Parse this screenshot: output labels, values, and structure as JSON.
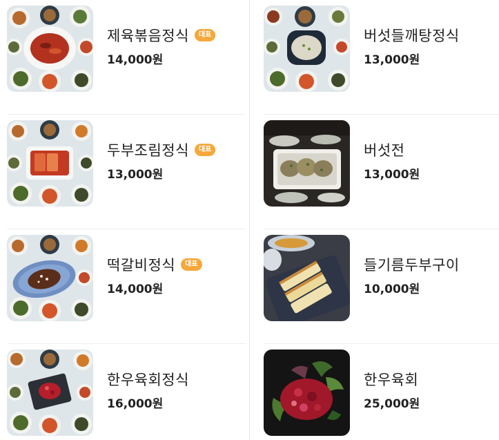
{
  "menu": {
    "items": [
      {
        "name": "제육볶음정식",
        "badge": "대표",
        "price": "14,000원",
        "image": "jeyuk-set"
      },
      {
        "name": "버섯들깨탕정식",
        "badge": "",
        "price": "13,000원",
        "image": "mushroom-perilla-soup-set"
      },
      {
        "name": "두부조림정식",
        "badge": "대표",
        "price": "13,000원",
        "image": "braised-tofu-set"
      },
      {
        "name": "버섯전",
        "badge": "",
        "price": "13,000원",
        "image": "mushroom-pancake"
      },
      {
        "name": "떡갈비정식",
        "badge": "대표",
        "price": "14,000원",
        "image": "tteokgalbi-set"
      },
      {
        "name": "들기름두부구이",
        "badge": "",
        "price": "10,000원",
        "image": "grilled-tofu"
      },
      {
        "name": "한우육회정식",
        "badge": "",
        "price": "16,000원",
        "image": "hanwoo-yukhoe-set"
      },
      {
        "name": "한우육회",
        "badge": "",
        "price": "25,000원",
        "image": "hanwoo-yukhoe"
      }
    ]
  },
  "colors": {
    "badge": "#f6a83b",
    "divider": "#e4e4e4",
    "text": "#222222"
  }
}
